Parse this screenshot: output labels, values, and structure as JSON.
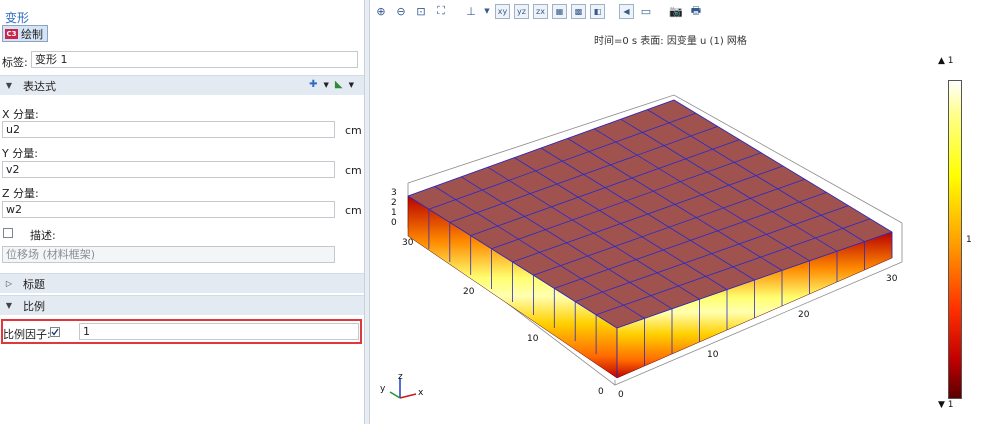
{
  "panel": {
    "title": "变形",
    "plot_button": "绘制",
    "plot_icon_text": "C3",
    "label_caption": "标签:",
    "label_value": "变形 1",
    "sections": {
      "expression": "表达式",
      "title": "标题",
      "scale": "比例"
    },
    "x_caption": "X 分量:",
    "x_value": "u2",
    "y_caption": "Y 分量:",
    "y_value": "v2",
    "z_caption": "Z 分量:",
    "z_value": "w2",
    "unit": "cm",
    "description_caption": "描述:",
    "description_value": "位移场 (材料框架)",
    "scale_factor_caption": "比例因子:",
    "scale_factor_value": "1",
    "scale_factor_checked": true,
    "description_checked": false
  },
  "graphics": {
    "subtitle": "时间=0 s    表面: 因变量 u (1) 网格",
    "colorbar": {
      "max_label": "▲ 1",
      "mid_label": "1",
      "min_label": "▼ 1"
    },
    "axis_ticks": {
      "z": [
        "3",
        "2",
        "1",
        "0"
      ],
      "y": [
        "30",
        "20",
        "10",
        "0"
      ],
      "x": [
        "0",
        "10",
        "20",
        "30"
      ]
    },
    "triad": {
      "x": "x",
      "y": "y",
      "z": "z"
    },
    "colors": {
      "top_face": "#a0524e",
      "mesh": "#2a2ac8",
      "red_frame": "#e0383a",
      "accent": "#2a6bc4"
    }
  }
}
